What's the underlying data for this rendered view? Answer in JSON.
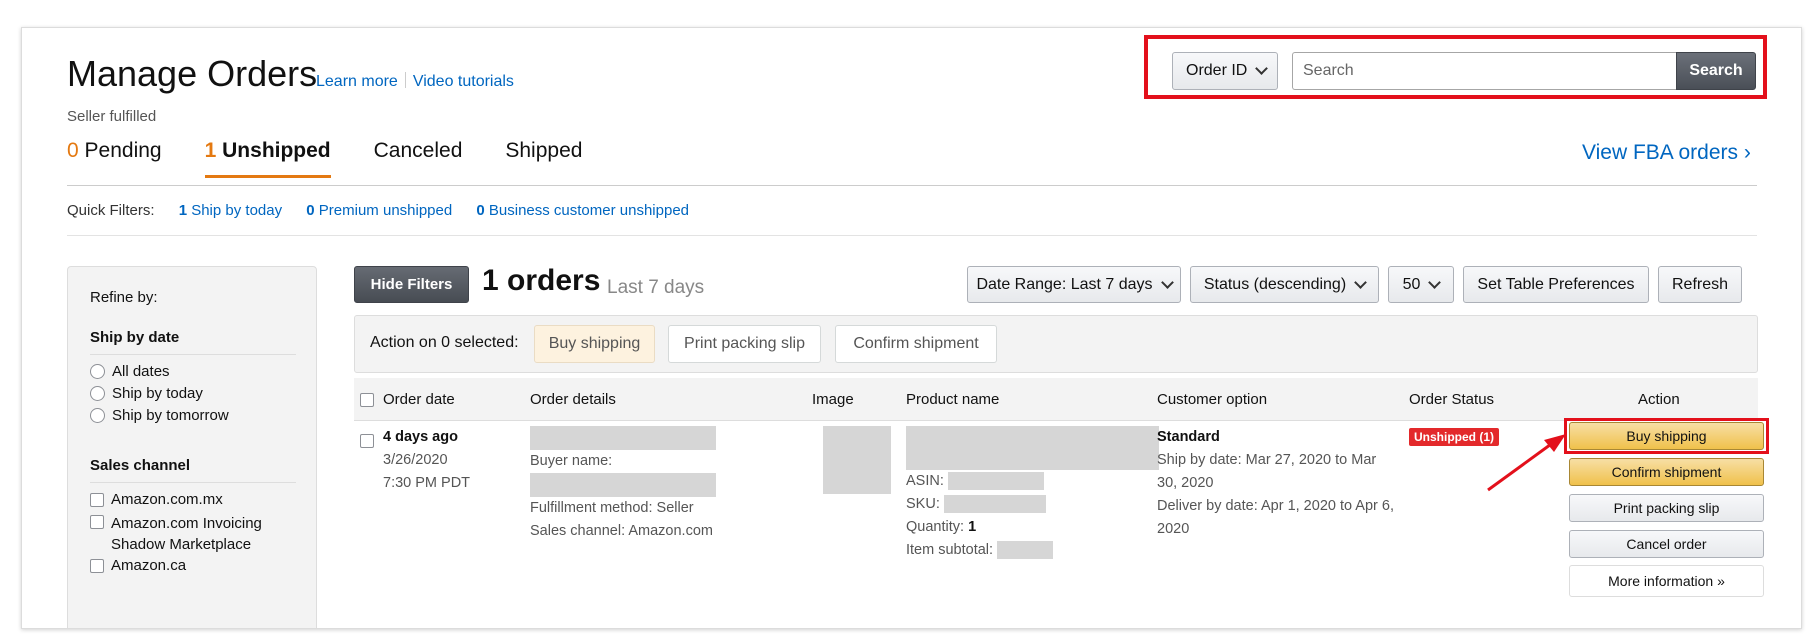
{
  "header": {
    "title": "Manage Orders",
    "learn_more": "Learn more",
    "video_tutorials": "Video tutorials",
    "subtitle": "Seller fulfilled"
  },
  "search": {
    "type_label": "Order ID",
    "placeholder": "Search",
    "button": "Search"
  },
  "tabs": [
    {
      "count": "0",
      "label": "Pending"
    },
    {
      "count": "1",
      "label": "Unshipped"
    },
    {
      "label": "Canceled"
    },
    {
      "label": "Shipped"
    }
  ],
  "view_fba": "View FBA orders ›",
  "quick_filters": {
    "label": "Quick Filters:",
    "items": [
      {
        "count": "1",
        "label": "Ship by today"
      },
      {
        "count": "0",
        "label": "Premium unshipped"
      },
      {
        "count": "0",
        "label": "Business customer unshipped"
      }
    ]
  },
  "sidebar": {
    "refine_label": "Refine by:",
    "ship_by_date": {
      "heading": "Ship by date",
      "options": [
        "All dates",
        "Ship by today",
        "Ship by tomorrow"
      ]
    },
    "sales_channel": {
      "heading": "Sales channel",
      "options": [
        "Amazon.com.mx",
        "Amazon.com Invoicing Shadow Marketplace",
        "Amazon.ca"
      ]
    }
  },
  "toolbar": {
    "hide_filters": "Hide Filters",
    "orders_count": "1 orders",
    "orders_range": "Last 7 days",
    "date_range": "Date Range: Last 7 days",
    "sort": "Status (descending)",
    "page_size": "50",
    "table_prefs": "Set Table Preferences",
    "refresh": "Refresh"
  },
  "action_bar": {
    "label": "Action on 0 selected:",
    "buy_shipping": "Buy shipping",
    "print_slip": "Print packing slip",
    "confirm_shipment": "Confirm shipment"
  },
  "table": {
    "headers": [
      "Order date",
      "Order details",
      "Image",
      "Product name",
      "Customer option",
      "Order Status",
      "Action"
    ],
    "row": {
      "age": "4 days ago",
      "date": "3/26/2020",
      "time": "7:30 PM PDT",
      "buyer_label": "Buyer name:",
      "fulfillment": "Fulfillment method: Seller",
      "sales_channel": "Sales channel: Amazon.com",
      "asin_label": "ASIN:",
      "sku_label": "SKU:",
      "quantity_label": "Quantity:",
      "quantity": "1",
      "subtotal_label": "Item subtotal:",
      "shipping_service": "Standard",
      "ship_by": "Ship by date: Mar 27, 2020 to Mar 30, 2020",
      "deliver_by": "Deliver by date: Apr 1, 2020 to Apr 6, 2020",
      "status": "Unshipped (1)",
      "actions": {
        "buy_shipping": "Buy shipping",
        "confirm_shipment": "Confirm shipment",
        "print_slip": "Print packing slip",
        "cancel_order": "Cancel order",
        "more_info": "More information »"
      }
    }
  },
  "colors": {
    "accent_orange": "#e47911",
    "link_blue": "#0066c0",
    "highlight_red": "#e3101b",
    "status_red": "#e3292b"
  }
}
